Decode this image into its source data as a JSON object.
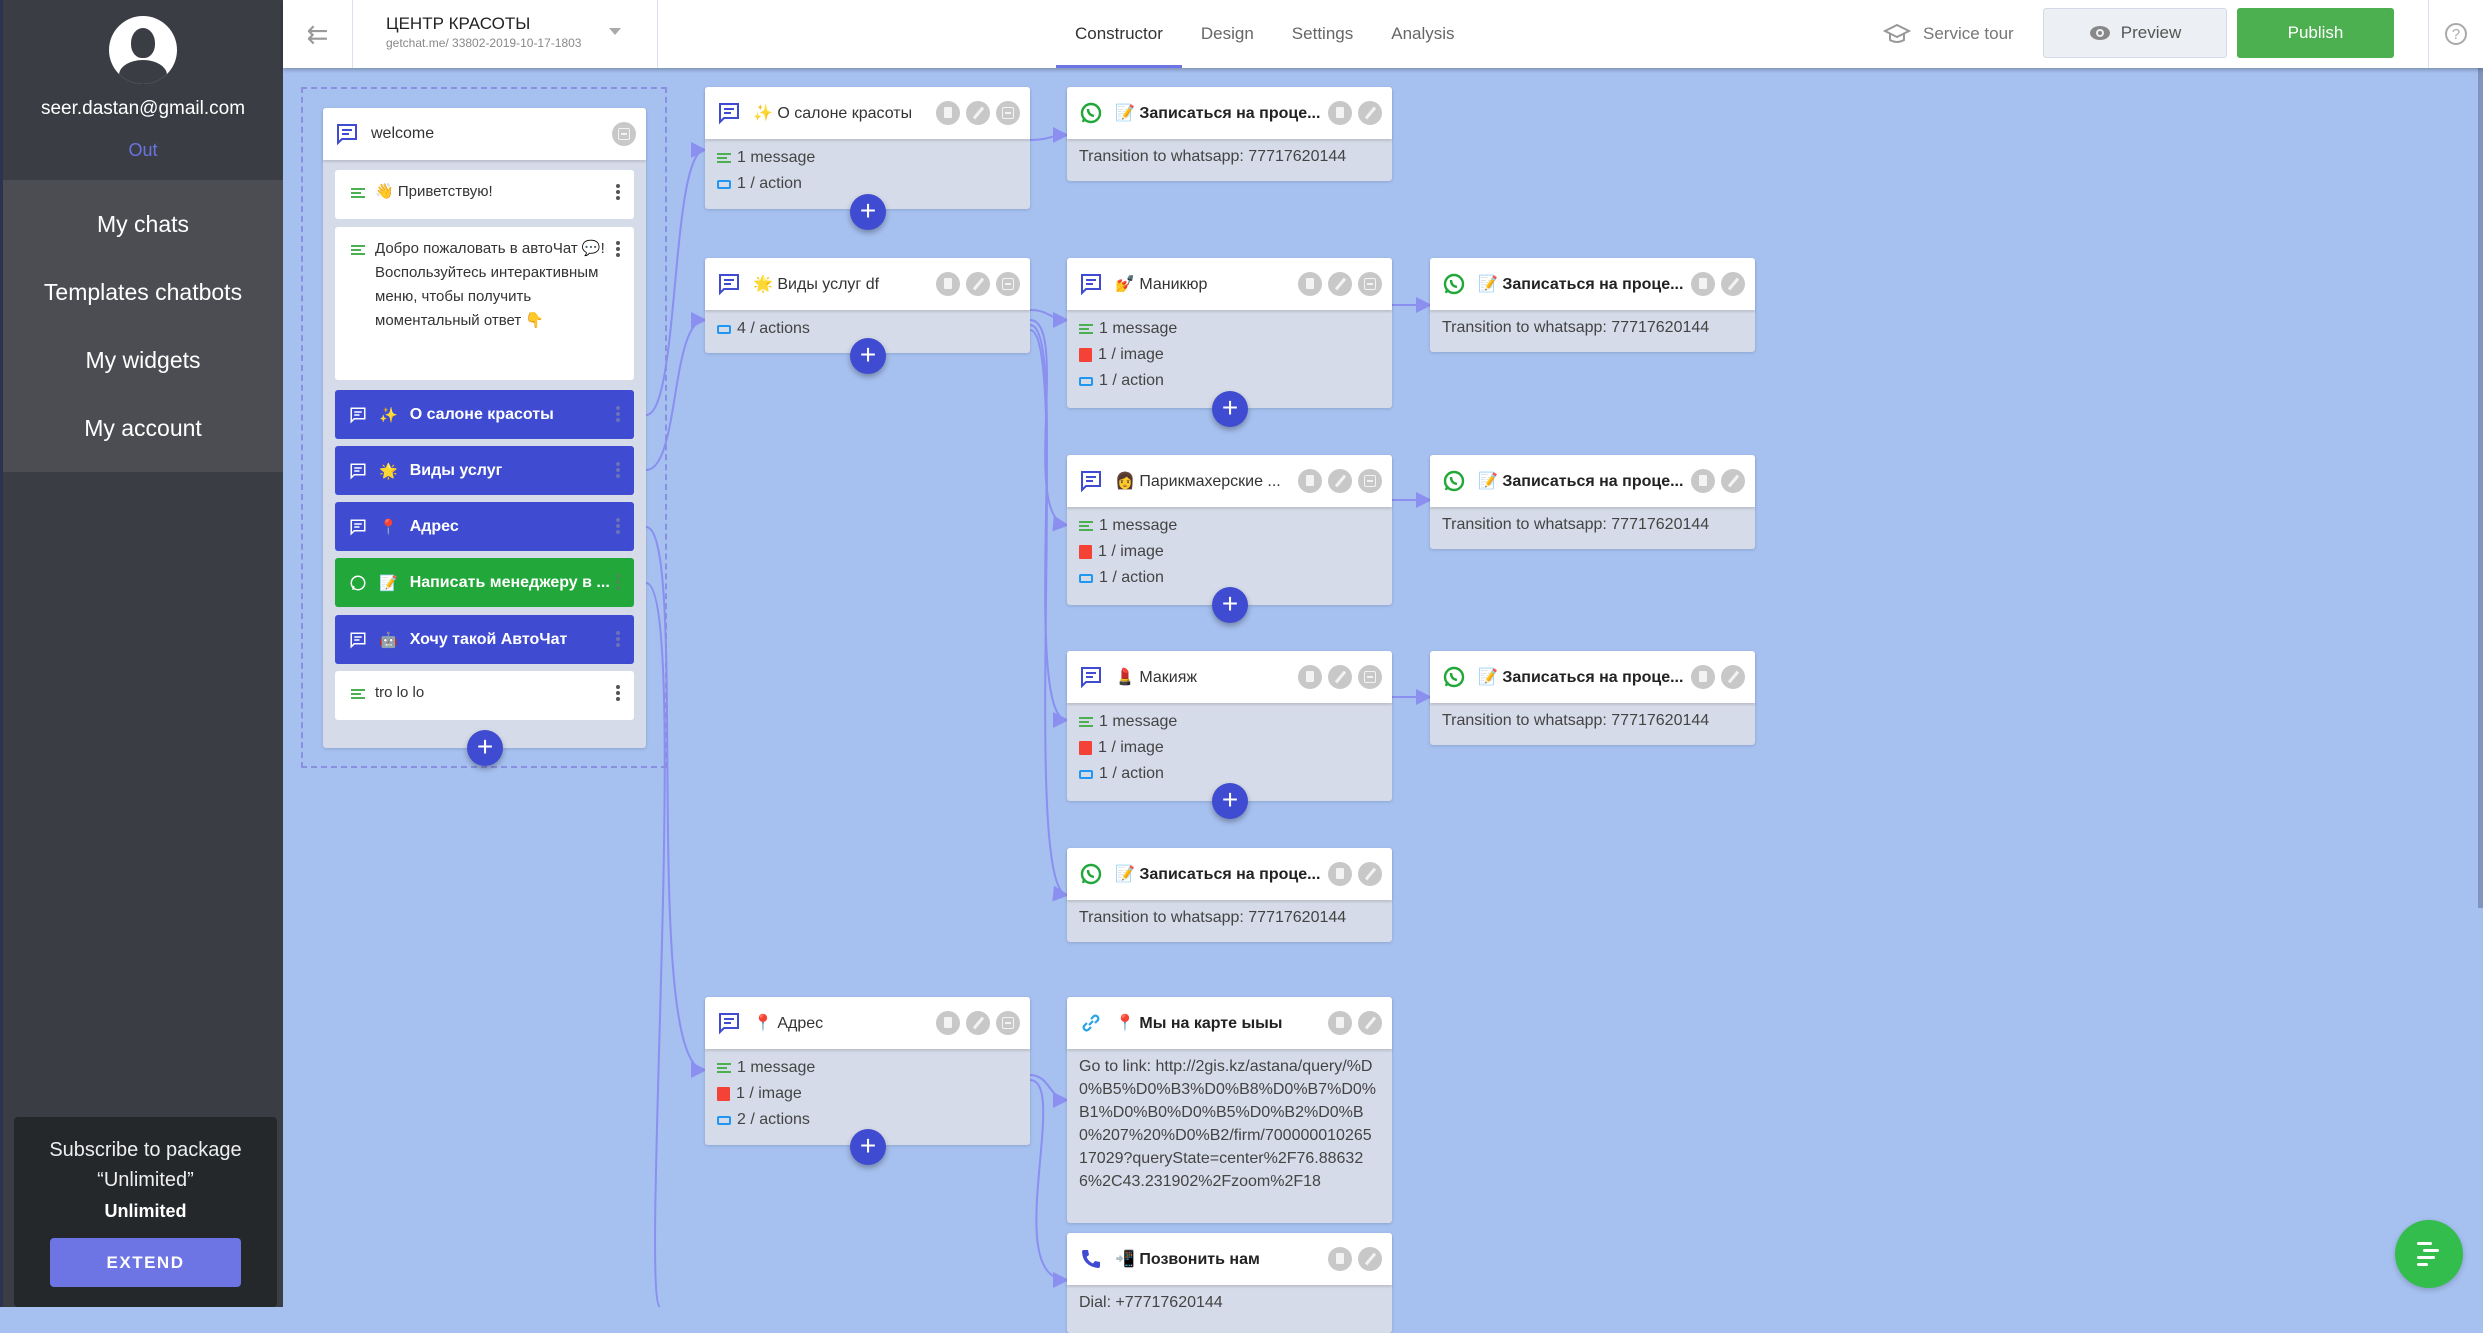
{
  "sidebar": {
    "email": "seer.dastan@gmail.com",
    "logout": "Out",
    "menu": [
      "My chats",
      "Templates chatbots",
      "My widgets",
      "My account"
    ],
    "promo": {
      "line1": "Subscribe to package",
      "line2": "“Unlimited”",
      "plan": "Unlimited",
      "button": "EXTEND"
    }
  },
  "header": {
    "bot_name": "ЦЕНТР КРАСОТЫ",
    "bot_url": "getchat.me/ 33802-2019-10-17-1803",
    "tabs": [
      "Constructor",
      "Design",
      "Settings",
      "Analysis"
    ],
    "active_tab": "Constructor",
    "service_tour": "Service tour",
    "preview": "Preview",
    "publish": "Publish"
  },
  "welcome": {
    "title": "welcome",
    "messages": [
      {
        "emoji": "👋",
        "text": "Приветствую!"
      },
      {
        "text": "Добро пожаловать в автоЧат 💬! Воспользуйтесь интерактивным меню, чтобы получить моментальный ответ 👇"
      }
    ],
    "buttons": [
      {
        "emoji": "✨",
        "label": "О салоне красоты",
        "type": "message"
      },
      {
        "emoji": "🌟",
        "label": "Виды услуг",
        "type": "message"
      },
      {
        "emoji": "📍",
        "label": "Адрес",
        "type": "message"
      },
      {
        "emoji": "📝",
        "label": "Написать менеджеру в ...",
        "type": "whatsapp"
      },
      {
        "emoji": "🤖",
        "label": "Хочу такой АвтоЧат",
        "type": "message"
      }
    ],
    "last_message": "tro lo lo"
  },
  "blocks": {
    "about": {
      "emoji": "✨",
      "title": "О салоне красоты",
      "stats": [
        "1 message",
        "1 / action"
      ]
    },
    "services": {
      "emoji": "🌟",
      "title": "Виды услуг df",
      "stats": [
        "4 / actions"
      ]
    },
    "manicure": {
      "emoji": "💅",
      "title": "Маникюр",
      "stats": [
        "1 message",
        "1 / image",
        "1 / action"
      ]
    },
    "hair": {
      "emoji": "👩",
      "title": "Парикмахерские ...",
      "stats": [
        "1 message",
        "1 / image",
        "1 / action"
      ]
    },
    "makeup": {
      "emoji": "💄",
      "title": "Макияж",
      "stats": [
        "1 message",
        "1 / image",
        "1 / action"
      ]
    },
    "address": {
      "emoji": "📍",
      "title": "Адрес",
      "stats": [
        "1 message",
        "1 / image",
        "2 / actions"
      ]
    },
    "whatsapp": {
      "emoji": "📝",
      "title": "Записаться на проце...",
      "body": "Transition to whatsapp: 77717620144"
    },
    "map_link": {
      "emoji": "📍",
      "title": "Мы на карте ыыы",
      "body": "Go to link: http://2gis.kz/astana/query/%D0%B5%D0%B3%D0%B8%D0%B7%D0%B1%D0%B0%D0%B5%D0%B2%D0%B0%207%20%D0%B2/firm/70000001026517029?queryState=center%2F76.886326%2C43.231902%2Fzoom%2F18"
    },
    "call": {
      "emoji": "📲",
      "title": "Позвонить нам",
      "body": "Dial: +77717620144"
    }
  },
  "colors": {
    "accent": "#3f4bd1",
    "whatsapp": "#22a83a",
    "publish": "#4caf50",
    "canvas": "#a6c0f0",
    "sidebar": "#3a3e44"
  }
}
